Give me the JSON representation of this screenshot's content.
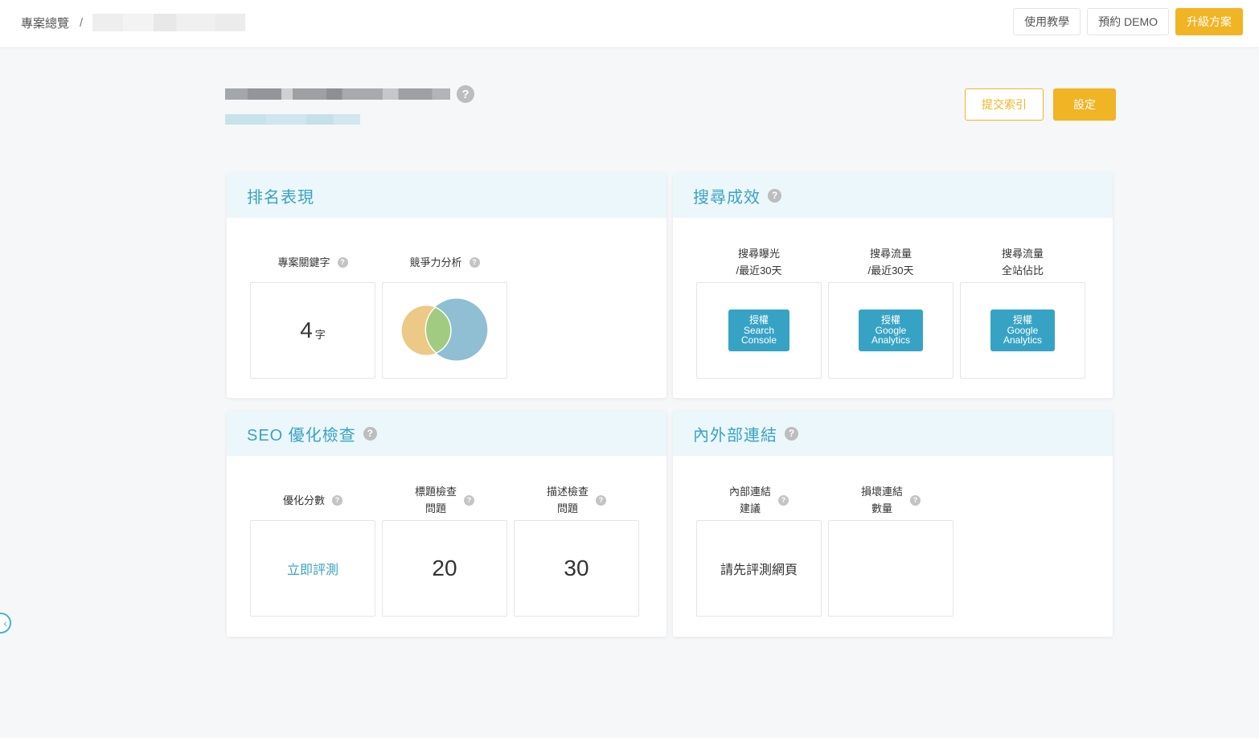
{
  "topbar": {
    "breadcrumb_root": "專案總覽",
    "breadcrumb_sep": "/",
    "buttons": {
      "tutorial": "使用教學",
      "demo": "預約 DEMO",
      "upgrade": "升級方案"
    }
  },
  "project": {
    "help": "?",
    "actions": {
      "submit_index": "提交索引",
      "settings": "設定"
    }
  },
  "cards": {
    "ranking": {
      "title": "排名表現",
      "metrics": [
        {
          "label": "專案關鍵字",
          "value": "4",
          "unit": "字"
        },
        {
          "label": "競爭力分析",
          "venn": {
            "left_color": "#ecc986",
            "right_color": "#90bed3",
            "overlap_color": "#a2cb82"
          }
        }
      ]
    },
    "search": {
      "title": "搜尋成效",
      "metrics": [
        {
          "label_line1": "搜尋曝光",
          "label_line2": "/最近30天",
          "button": {
            "line1": "授權",
            "line2": "Search",
            "line3": "Console"
          }
        },
        {
          "label_line1": "搜尋流量",
          "label_line2": "/最近30天",
          "button": {
            "line1": "授權",
            "line2": "Google",
            "line3": "Analytics"
          }
        },
        {
          "label_line1": "搜尋流量",
          "label_line2": "全站佔比",
          "button": {
            "line1": "授權",
            "line2": "Google",
            "line3": "Analytics"
          }
        }
      ]
    },
    "seo": {
      "title": "SEO 優化檢查",
      "metrics": [
        {
          "label_line1": "優化分數",
          "value": "立即評測"
        },
        {
          "label_line1": "標題檢查",
          "label_line2": "問題",
          "value": "20"
        },
        {
          "label_line1": "描述檢查",
          "label_line2": "問題",
          "value": "30"
        }
      ]
    },
    "links": {
      "title": "內外部連結",
      "metrics": [
        {
          "label_line1": "內部連結",
          "label_line2": "建議",
          "value": "請先評測網頁"
        },
        {
          "label_line1": "損壞連結",
          "label_line2": "數量",
          "value": ""
        }
      ]
    }
  },
  "help_glyph": "?",
  "sidebar_toggle": "‹"
}
